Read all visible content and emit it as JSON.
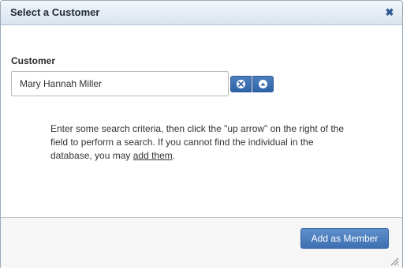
{
  "dialog": {
    "title": "Select a Customer",
    "close_icon": "close-icon"
  },
  "customer_field": {
    "label": "Customer",
    "value": "Mary Hannah Miller",
    "clear_icon": "clear-x-icon",
    "search_icon": "up-arrow-icon"
  },
  "help": {
    "text": "Enter some search criteria, then click the \"up arrow\" on the right of the field to perform a search. If you cannot find the individual in the database, you may ",
    "link_label": "add them",
    "suffix": "."
  },
  "footer": {
    "primary_button": "Add as Member",
    "resize_icon": "resize-grip-icon"
  },
  "colors": {
    "accent": "#3e6fb1",
    "titlebar": "#d9e3ee"
  }
}
